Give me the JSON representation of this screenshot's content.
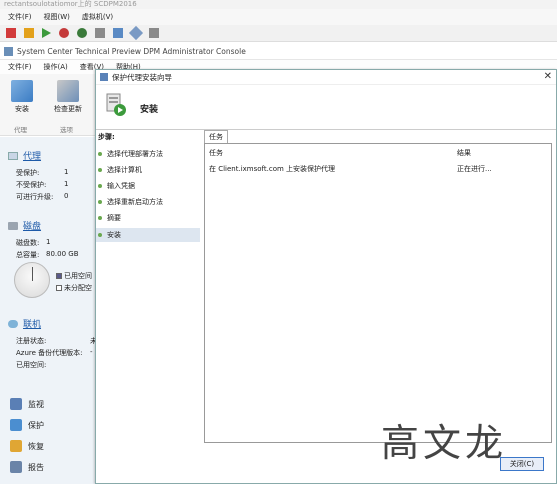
{
  "vm": {
    "title": "rectantsoulotatiomor上的 SCDPM2016",
    "menu": [
      "文件(F)",
      "视图(W)",
      "虚拟机(V)"
    ]
  },
  "console": {
    "title": "System Center Technical Preview DPM Administrator Console",
    "menu": [
      "文件(F)",
      "操作(A)",
      "查看(V)",
      "帮助(H)"
    ]
  },
  "ribbon": {
    "buttons": [
      "安装",
      "检查更新"
    ],
    "groups": [
      "代理",
      "选项"
    ]
  },
  "nav": {
    "agents": {
      "title": "代理",
      "rows": [
        {
          "label": "受保护:",
          "value": "1"
        },
        {
          "label": "不受保护:",
          "value": "1"
        },
        {
          "label": "可进行升级:",
          "value": "0"
        }
      ]
    },
    "disks": {
      "title": "磁盘",
      "count_label": "磁盘数:",
      "count_value": "1",
      "capacity_label": "总容量:",
      "capacity_value": "80.00 GB",
      "legend_used": "已用空间",
      "legend_unalloc": "未分配空"
    },
    "online": {
      "title": "联机",
      "rows": [
        "注册状态:",
        "Azure 备份代理版本:",
        "已用空间:"
      ],
      "values": [
        "未",
        "-",
        ""
      ]
    },
    "bottom": [
      {
        "label": "监视",
        "icon": "monitor-icon"
      },
      {
        "label": "保护",
        "icon": "protect-icon"
      },
      {
        "label": "恢复",
        "icon": "recovery-icon"
      },
      {
        "label": "报告",
        "icon": "report-icon"
      }
    ]
  },
  "wizard": {
    "title": "保护代理安装向导",
    "header": "安装",
    "steps_label": "步骤:",
    "steps": [
      "选择代理部署方法",
      "选择计算机",
      "输入凭据",
      "选择重新启动方法",
      "摘要",
      "安装"
    ],
    "active_step": 5,
    "tab": "任务",
    "columns": [
      "任务",
      "结果"
    ],
    "tasks": [
      {
        "task": "在 Client.ixmsoft.com 上安装保护代理",
        "result": "正在进行..."
      }
    ],
    "close_button": "关闭(C)",
    "watermark": "高文龙"
  },
  "colors": {
    "accent": "#1e5aa8",
    "nav_bg": "#eef3f8",
    "step_dot": "#6aa84f"
  }
}
